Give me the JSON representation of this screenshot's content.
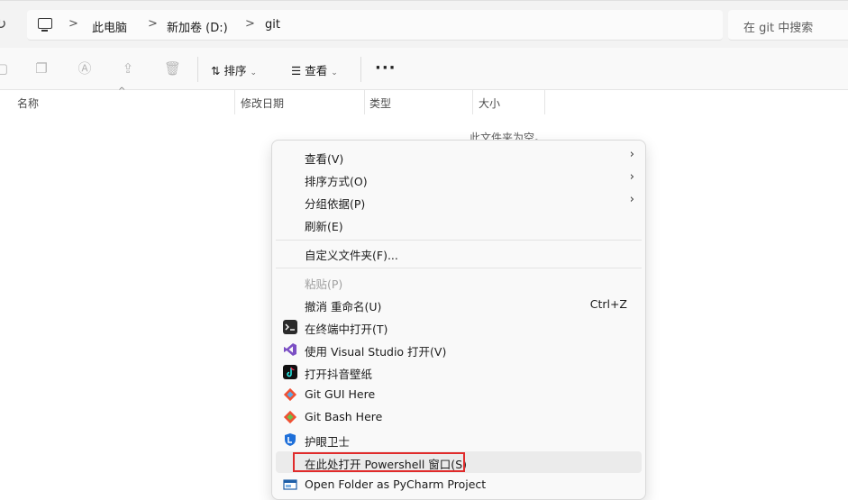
{
  "address_bar": {
    "breadcrumbs": [
      "此电脑",
      "新加卷 (D:)",
      "git"
    ],
    "separator": ">",
    "search_placeholder": "在 git 中搜索",
    "refresh_icon": "refresh-icon",
    "pc_icon": "computer-icon"
  },
  "toolbar": {
    "sort_label": "排序",
    "view_label": "查看",
    "more_label": "···",
    "icons": [
      "cut-icon",
      "copy-icon",
      "paste-icon",
      "rename-icon",
      "share-icon",
      "delete-icon"
    ]
  },
  "columns": {
    "name": "名称",
    "modified": "修改日期",
    "type": "类型",
    "size": "大小"
  },
  "empty_message": "此文件夹为空。",
  "context_menu": {
    "items": [
      {
        "label": "查看(V)",
        "shortcut": "",
        "submenu": true,
        "disabled": false
      },
      {
        "label": "排序方式(O)",
        "shortcut": "",
        "submenu": true,
        "disabled": false
      },
      {
        "label": "分组依据(P)",
        "shortcut": "",
        "submenu": true,
        "disabled": false
      },
      {
        "label": "刷新(E)",
        "shortcut": "",
        "submenu": false,
        "disabled": false
      },
      {
        "label": "自定义文件夹(F)...",
        "shortcut": "",
        "submenu": false,
        "disabled": false
      },
      {
        "label": "粘贴(P)",
        "shortcut": "",
        "submenu": false,
        "disabled": true
      },
      {
        "label": "撤消 重命名(U)",
        "shortcut": "Ctrl+Z",
        "submenu": false,
        "disabled": false
      },
      {
        "label": "在终端中打开(T)",
        "shortcut": "",
        "submenu": false,
        "disabled": false,
        "icon": "terminal-icon"
      },
      {
        "label": "使用 Visual Studio 打开(V)",
        "shortcut": "",
        "submenu": false,
        "disabled": false,
        "icon": "visual-studio-icon"
      },
      {
        "label": "打开抖音壁纸",
        "shortcut": "",
        "submenu": false,
        "disabled": false,
        "icon": "douyin-icon"
      },
      {
        "label": "Git GUI Here",
        "shortcut": "",
        "submenu": false,
        "disabled": false,
        "icon": "git-icon"
      },
      {
        "label": "Git Bash Here",
        "shortcut": "",
        "submenu": false,
        "disabled": false,
        "icon": "git-icon"
      },
      {
        "label": "护眼卫士",
        "shortcut": "",
        "submenu": false,
        "disabled": false,
        "icon": "eye-guard-icon"
      },
      {
        "label": "在此处打开 Powershell 窗口(S)",
        "shortcut": "",
        "submenu": false,
        "disabled": false,
        "highlighted": true
      },
      {
        "label": "Open Folder as PyCharm Project",
        "shortcut": "",
        "submenu": false,
        "disabled": false,
        "icon": "pycharm-icon"
      }
    ]
  },
  "colors": {
    "highlight_box": "#e02b2b",
    "vs_purple": "#7b4fc4",
    "git_orange": "#f05033",
    "eye_blue": "#1e6fd9"
  }
}
